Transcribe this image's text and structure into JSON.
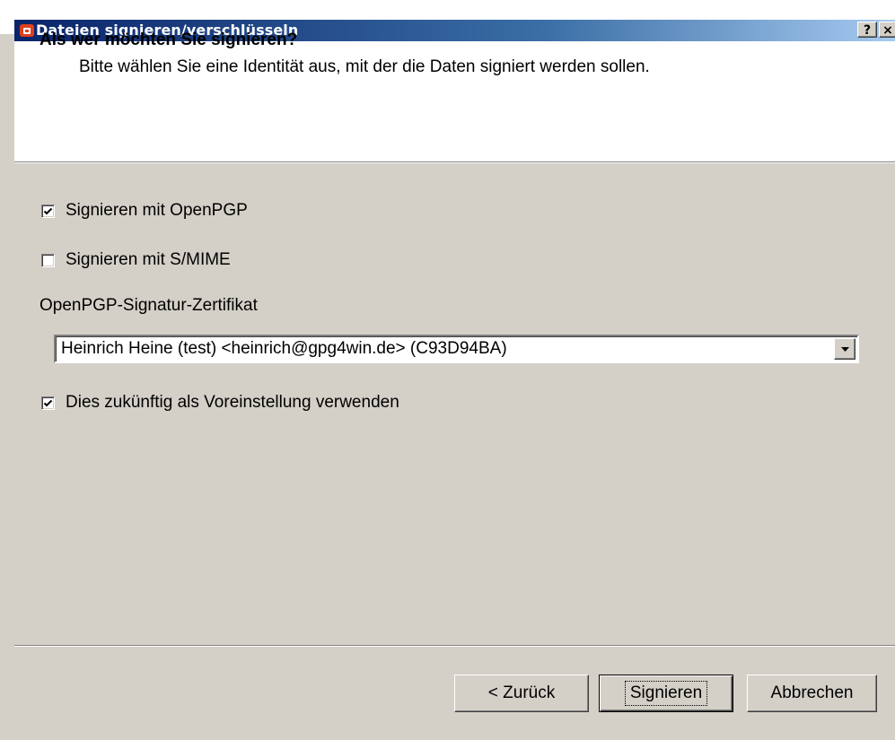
{
  "window": {
    "title": "Dateien signieren/verschlüsseln",
    "help_button": "?",
    "close_button": "×",
    "icon": "gpg4win-app-icon"
  },
  "header": {
    "title": "Als wer möchten Sie signieren?",
    "subtitle": "Bitte wählen Sie eine Identität aus, mit der die Daten signiert werden sollen."
  },
  "options": {
    "openpgp": {
      "label": "Signieren mit OpenPGP",
      "checked": true
    },
    "smime": {
      "label": "Signieren mit S/MIME",
      "checked": false
    },
    "certificate_label": "OpenPGP-Signatur-Zertifikat",
    "certificate_value": "Heinrich Heine (test) <heinrich@gpg4win.de> (C93D94BA)",
    "remember": {
      "label": "Dies zukünftig als Voreinstellung verwenden",
      "checked": true
    }
  },
  "footer": {
    "back_label": "< Zurück",
    "sign_label": "Signieren",
    "cancel_label": "Abbrechen"
  }
}
